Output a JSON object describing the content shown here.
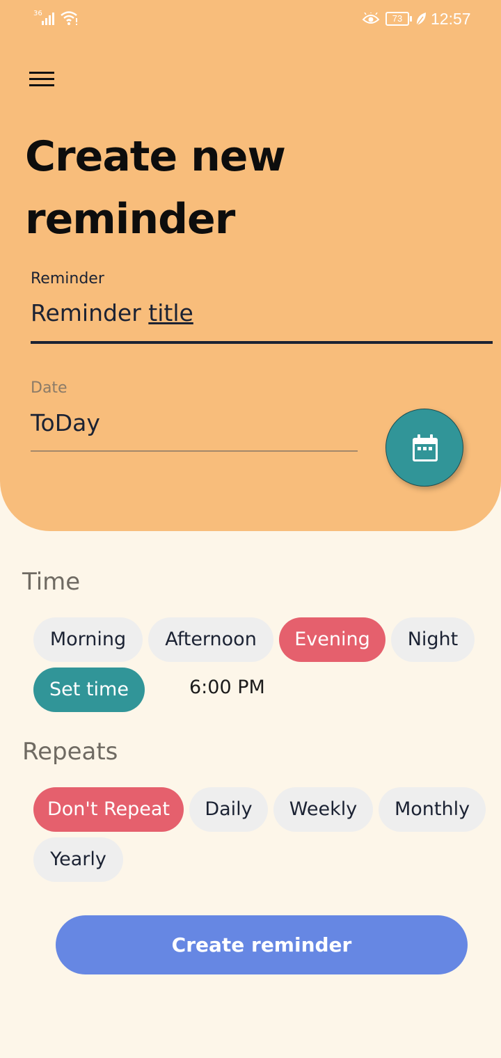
{
  "status_bar": {
    "network": "36",
    "battery": "73",
    "time": "12:57",
    "icons": [
      "signal-icon",
      "wifi-icon",
      "eye-icon",
      "battery-icon",
      "leaf-icon"
    ]
  },
  "header": {
    "menu_icon": "hamburger-menu-icon",
    "title": "Create new reminder"
  },
  "reminder_field": {
    "label": "Reminder",
    "value_part1": "Reminder ",
    "value_part2": "title"
  },
  "date_field": {
    "label": "Date",
    "value": "ToDay",
    "picker_icon": "calendar-icon"
  },
  "time_section": {
    "title": "Time",
    "chips": [
      "Morning",
      "Afternoon",
      "Evening",
      "Night"
    ],
    "selected": "Evening",
    "set_time_label": "Set time",
    "time_value": "6:00 PM"
  },
  "repeats_section": {
    "title": "Repeats",
    "chips": [
      "Don't Repeat",
      "Daily",
      "Weekly",
      "Monthly",
      "Yearly"
    ],
    "selected": "Don't Repeat"
  },
  "create_button": {
    "label": "Create reminder"
  },
  "colors": {
    "header_bg": "#f8bd7b",
    "page_bg": "#fdf6e9",
    "accent_red": "#e5606d",
    "accent_teal": "#319598",
    "button_blue": "#6687e3"
  }
}
